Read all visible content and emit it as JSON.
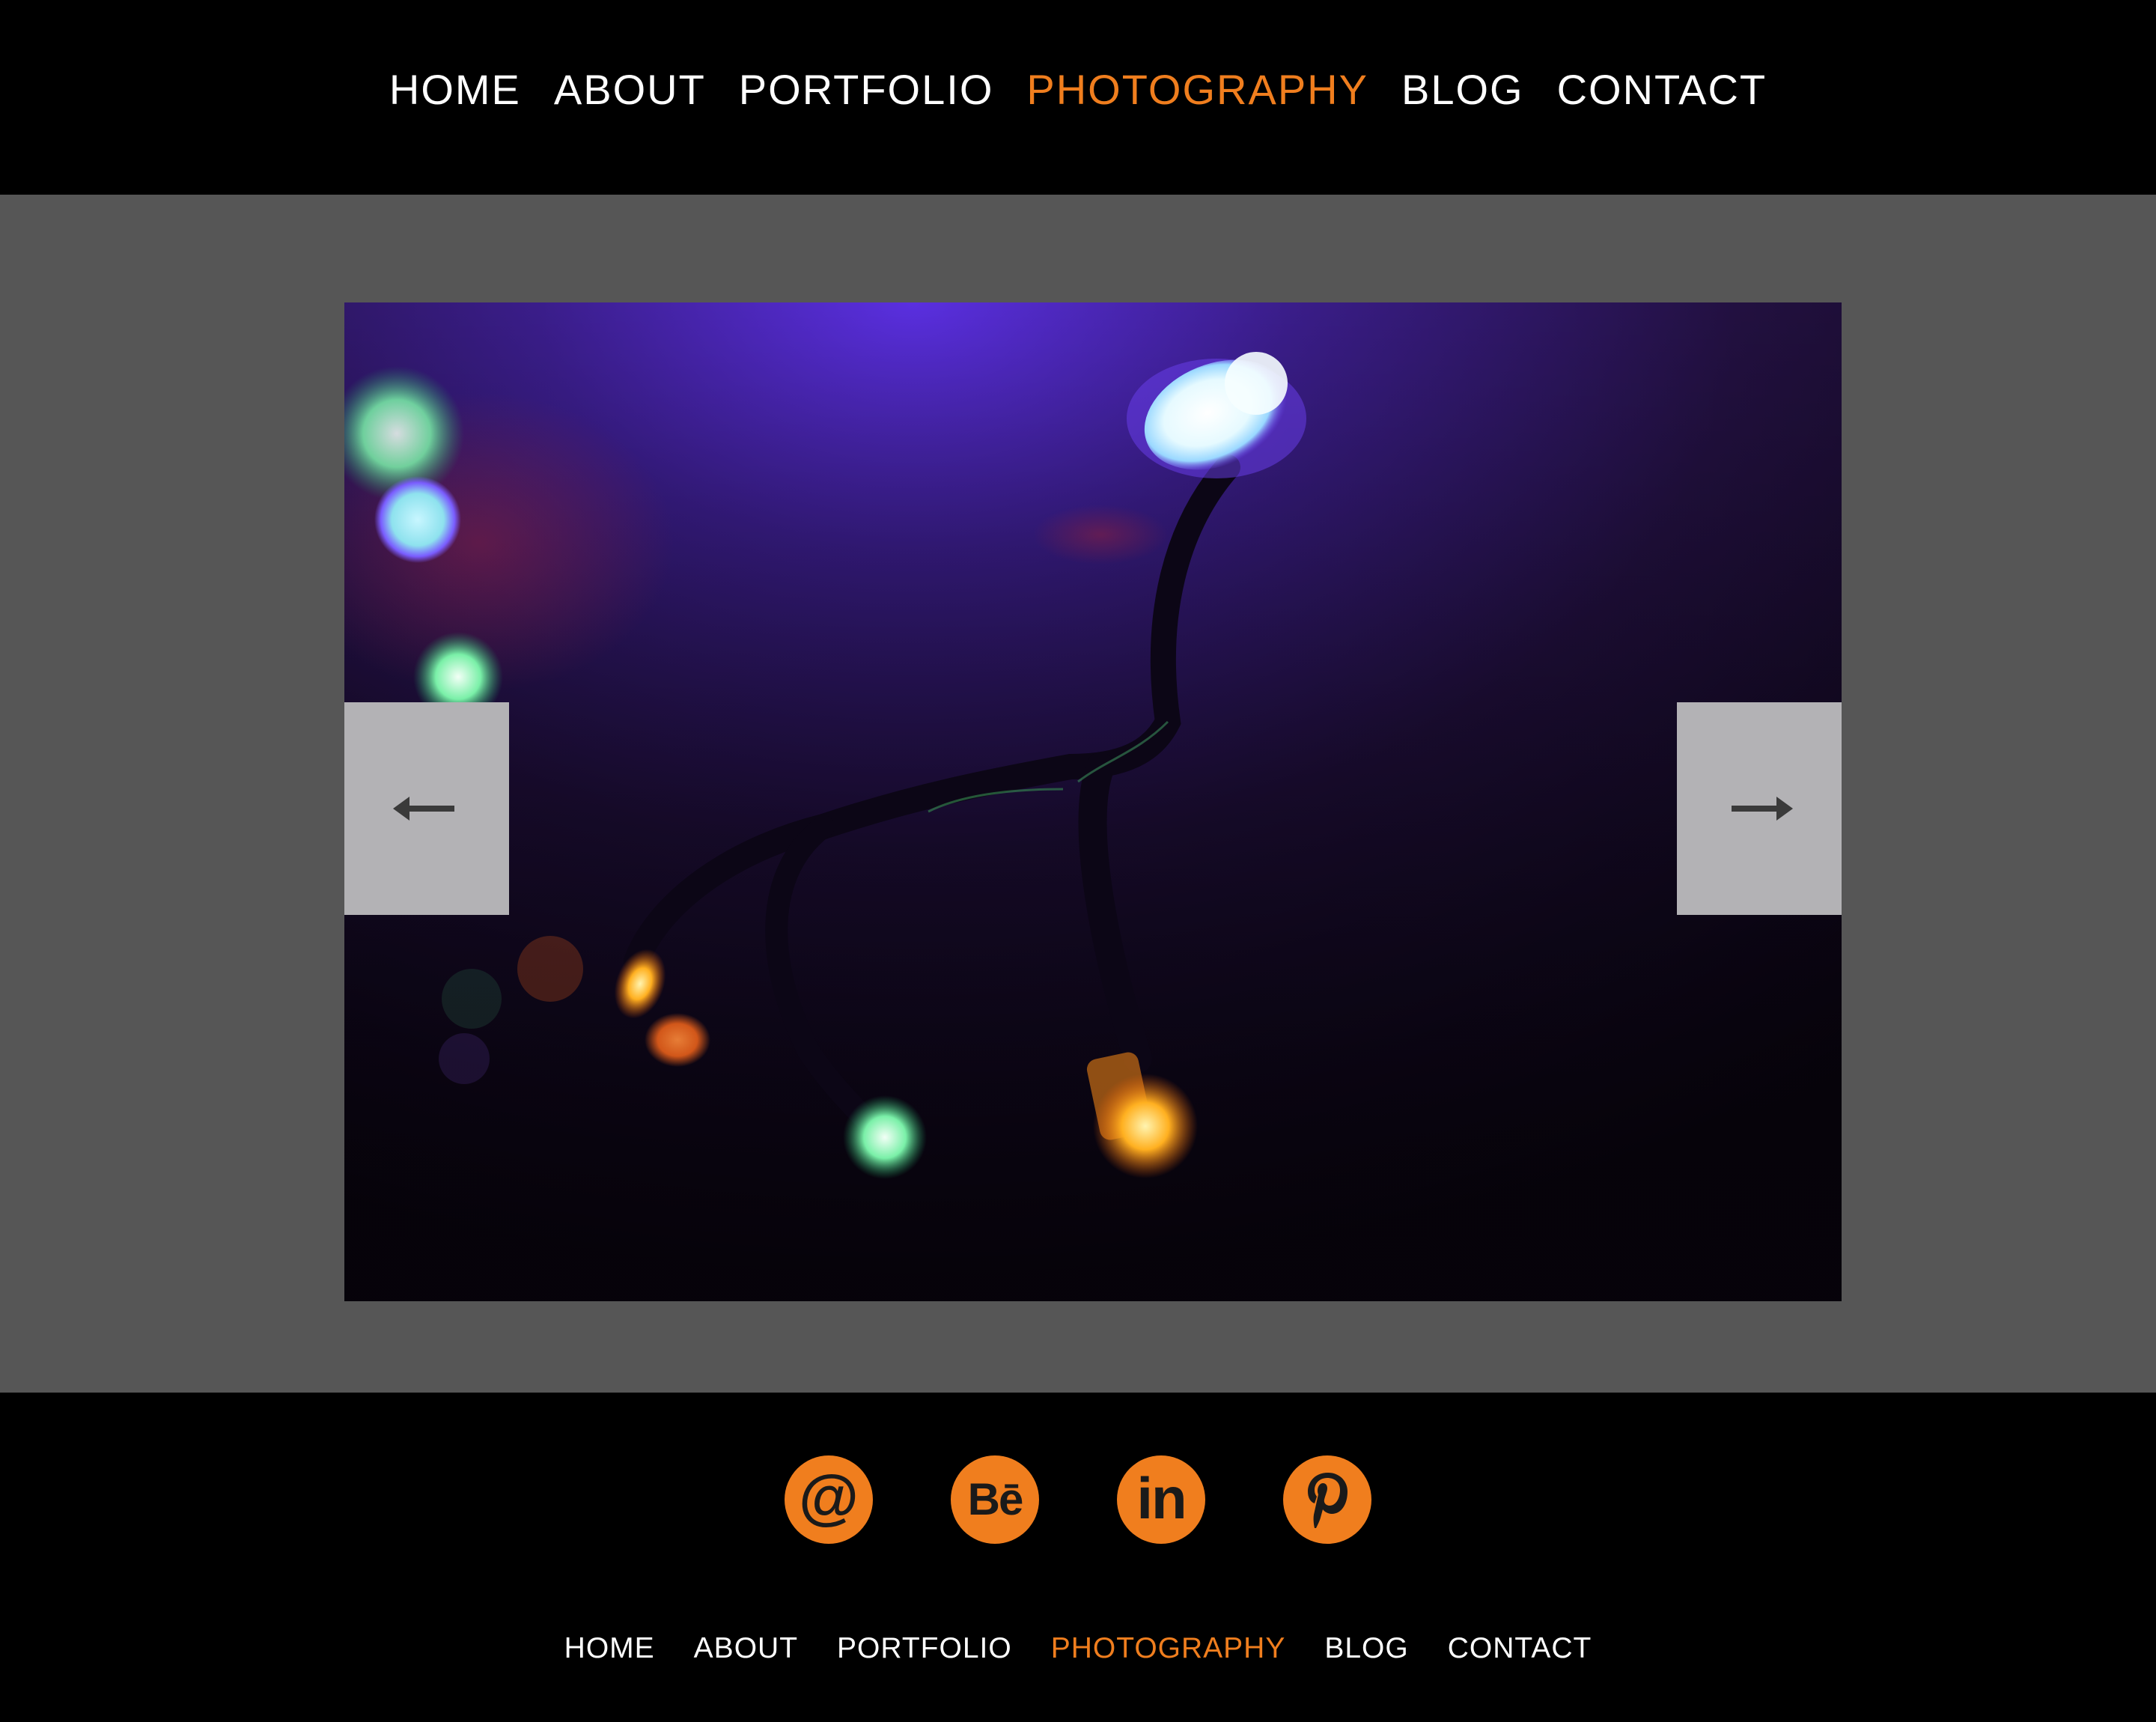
{
  "nav": {
    "items": [
      {
        "label": "HOME"
      },
      {
        "label": "ABOUT"
      },
      {
        "label": "PORTFOLIO"
      },
      {
        "label": "PHOTOGRAPHY"
      },
      {
        "label": "BLOG"
      },
      {
        "label": "CONTACT"
      }
    ],
    "active": "PHOTOGRAPHY"
  },
  "gallery": {
    "prev_icon": "arrow-left-icon",
    "next_icon": "arrow-right-icon"
  },
  "social": {
    "items": [
      {
        "icon": "email-icon",
        "glyph": "@"
      },
      {
        "icon": "behance-icon",
        "glyph": "Bē"
      },
      {
        "icon": "linkedin-icon",
        "glyph": "in"
      },
      {
        "icon": "pinterest-icon",
        "glyph": "p"
      }
    ]
  },
  "footer_nav": {
    "items": [
      {
        "label": "HOME"
      },
      {
        "label": "ABOUT"
      },
      {
        "label": "PORTFOLIO"
      },
      {
        "label": "PHOTOGRAPHY"
      },
      {
        "label": "BLOG"
      },
      {
        "label": "CONTACT"
      }
    ],
    "active": "PHOTOGRAPHY"
  },
  "colors": {
    "accent": "#F07E1E",
    "header_bg": "#000000",
    "stage_bg": "#565656",
    "arrow_bg": "#B3B2B5"
  }
}
